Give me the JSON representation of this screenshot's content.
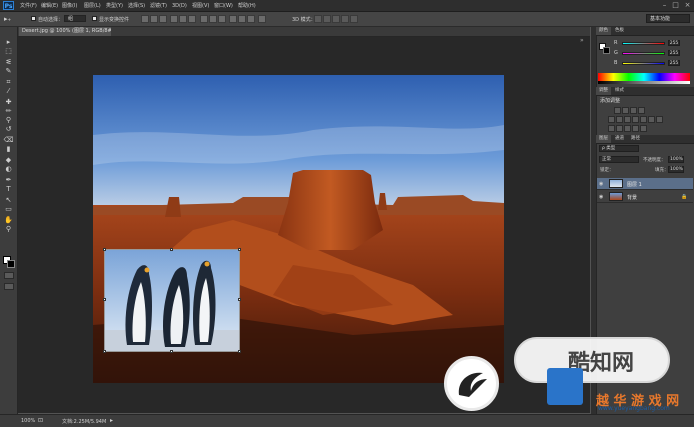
{
  "app": {
    "logo": "Ps"
  },
  "menu": [
    "文件(F)",
    "编辑(E)",
    "图像(I)",
    "图层(L)",
    "类型(Y)",
    "选择(S)",
    "滤镜(T)",
    "3D(D)",
    "视图(V)",
    "窗口(W)",
    "帮助(H)"
  ],
  "window_buttons": [
    "–",
    "□",
    "×"
  ],
  "options": {
    "auto_select_label": "自动选择：",
    "auto_select_value": "组",
    "show_transform_label": "显示变换控件",
    "mode_3d": "3D 模式：",
    "workspace": "基本功能"
  },
  "document": {
    "tab_label": "Desert.jpg @ 100% (图层 1, RGB/8#) *"
  },
  "status": {
    "zoom": "100%",
    "doc_size": "文档:2.25M/5.94M"
  },
  "tools_icons": [
    "move-icon",
    "marquee-icon",
    "lasso-icon",
    "quick-select-icon",
    "crop-icon",
    "eyedropper-icon",
    "healing-icon",
    "brush-icon",
    "stamp-icon",
    "history-brush-icon",
    "eraser-icon",
    "gradient-icon",
    "blur-icon",
    "dodge-icon",
    "pen-icon",
    "type-icon",
    "path-select-icon",
    "shape-icon",
    "hand-icon",
    "zoom-icon"
  ],
  "tool_glyphs": [
    "▸",
    "⬚",
    "ᓬ",
    "✎",
    "⌗",
    "⁄",
    "✚",
    "✏",
    "⚲",
    "↺",
    "⌫",
    "▮",
    "◆",
    "◐",
    "✒",
    "T",
    "↖",
    "▭",
    "✋",
    "⚲"
  ],
  "color_panel": {
    "tabs": [
      "颜色",
      "色板"
    ],
    "channels": [
      {
        "label": "R",
        "value": "255",
        "color": "#ff4a4a"
      },
      {
        "label": "G",
        "value": "255",
        "color": "#4aff4a"
      },
      {
        "label": "B",
        "value": "255",
        "color": "#4a6bff"
      }
    ]
  },
  "adjust_panel": {
    "tabs": [
      "调整",
      "样式"
    ],
    "title": "添加调整"
  },
  "layers_panel": {
    "tabs": [
      "图层",
      "通道",
      "路径"
    ],
    "filter": "ρ 类型",
    "blend_mode": "正常",
    "opacity_label": "不透明度：",
    "opacity_value": "100%",
    "lock_label": "锁定：",
    "fill_label": "填充：",
    "fill_value": "100%",
    "layers": [
      {
        "name": "图层 1",
        "selected": true
      },
      {
        "name": "背景",
        "selected": false
      }
    ]
  },
  "watermark": {
    "brand": "酷知网",
    "site": "越 华 游 戏 网",
    "url": "www.yueyangbang.com"
  }
}
